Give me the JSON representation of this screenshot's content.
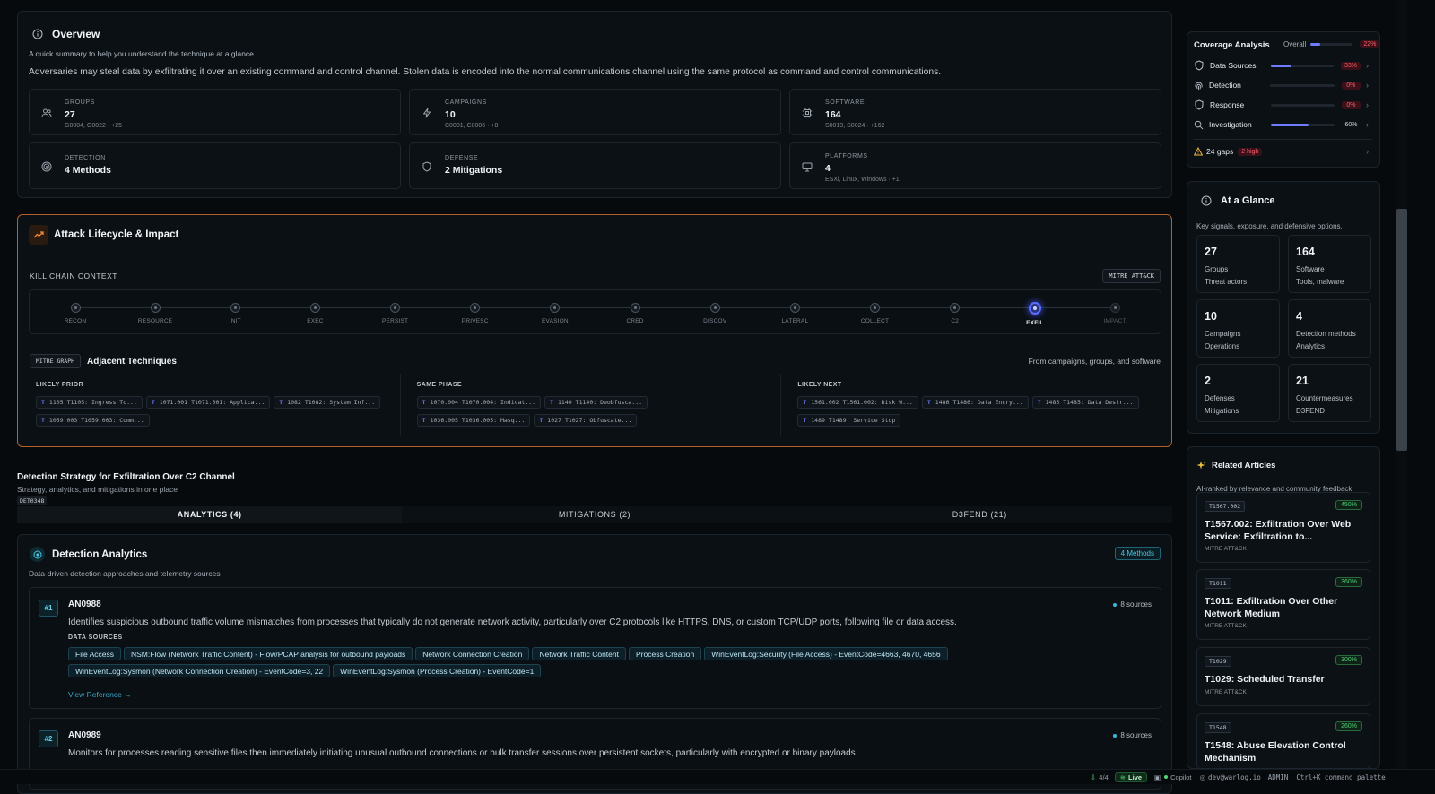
{
  "overview": {
    "title": "Overview",
    "subtitle": "A quick summary to help you understand the technique at a glance.",
    "description": "Adversaries may steal data by exfiltrating it over an existing command and control channel. Stolen data is encoded into the normal communications channel using the same protocol as command and control communications.",
    "stats": [
      {
        "label": "GROUPS",
        "value": "27",
        "sub": "G0004, G0022 · +25",
        "icon": "users-icon"
      },
      {
        "label": "CAMPAIGNS",
        "value": "10",
        "sub": "C0001, C0006 · +8",
        "icon": "lightning-icon"
      },
      {
        "label": "SOFTWARE",
        "value": "164",
        "sub": "S0013, S0024 · +162",
        "icon": "chip-icon"
      },
      {
        "label": "DETECTION",
        "value": "4 Methods",
        "sub": "",
        "icon": "target-icon"
      },
      {
        "label": "DEFENSE",
        "value": "2 Mitigations",
        "sub": "",
        "icon": "shield-icon"
      },
      {
        "label": "PLATFORMS",
        "value": "4",
        "sub": "ESXi, Linux, Windows · +1",
        "icon": "monitor-icon"
      }
    ]
  },
  "lifecycle": {
    "title": "Attack Lifecycle & Impact",
    "kill_chain_label": "KILL CHAIN CONTEXT",
    "badge": "MITRE ATT&CK",
    "phases": [
      "RECON",
      "RESOURCE",
      "INIT",
      "EXEC",
      "PERSIST",
      "PRIVESC",
      "EVASION",
      "CRED",
      "DISCOV",
      "LATERAL",
      "COLLECT",
      "C2",
      "EXFIL",
      "IMPACT"
    ],
    "active_phase": "EXFIL",
    "adjacent_badge": "MITRE GRAPH",
    "adjacent_title": "Adjacent Techniques",
    "adjacent_note": "From campaigns, groups, and software",
    "columns": [
      {
        "heading": "LIKELY PRIOR",
        "items": [
          {
            "id": "1105",
            "label": "T1105: Ingress To..."
          },
          {
            "id": "1071.001",
            "label": "T1071.001: Applica..."
          },
          {
            "id": "1082",
            "label": "T1082: System Inf..."
          },
          {
            "id": "1059.003",
            "label": "T1059.003: Comm..."
          }
        ]
      },
      {
        "heading": "SAME PHASE",
        "items": [
          {
            "id": "1070.004",
            "label": "T1070.004: Indicat..."
          },
          {
            "id": "1140",
            "label": "T1140: Deobfusca..."
          },
          {
            "id": "1036.005",
            "label": "T1036.005: Masq..."
          },
          {
            "id": "1027",
            "label": "T1027: Obfuscate..."
          }
        ]
      },
      {
        "heading": "LIKELY NEXT",
        "items": [
          {
            "id": "1561.002",
            "label": "T1561.002: Disk W..."
          },
          {
            "id": "1486",
            "label": "T1486: Data Encry..."
          },
          {
            "id": "1485",
            "label": "T1485: Data Destr..."
          },
          {
            "id": "1489",
            "label": "T1489: Service Stop"
          }
        ]
      }
    ]
  },
  "strategy": {
    "title": "Detection Strategy for Exfiltration Over C2 Channel",
    "subtitle": "Strategy, analytics, and mitigations in one place",
    "id": "DET0348",
    "tabs": [
      "ANALYTICS (4)",
      "MITIGATIONS (2)",
      "D3FEND (21)"
    ]
  },
  "analytics": {
    "title": "Detection Analytics",
    "subtitle": "Data-driven detection approaches and telemetry sources",
    "badge": "4 Methods",
    "data_sources_label": "DATA SOURCES",
    "items": [
      {
        "rank": "#1",
        "id": "AN0988",
        "sources": "8 sources",
        "description": "Identifies suspicious outbound traffic volume mismatches from processes that typically do not generate network activity, particularly over C2 protocols like HTTPS, DNS, or custom TCP/UDP ports, following file or data access.",
        "data_sources": [
          "File Access",
          "NSM:Flow (Network Traffic Content) - Flow/PCAP analysis for outbound payloads",
          "Network Connection Creation",
          "Network Traffic Content",
          "Process Creation",
          "WinEventLog:Security (File Access) - EventCode=4663, 4670, 4656",
          "WinEventLog:Sysmon (Network Connection Creation) - EventCode=3, 22",
          "WinEventLog:Sysmon (Process Creation) - EventCode=1"
        ],
        "link": "View Reference →"
      },
      {
        "rank": "#2",
        "id": "AN0989",
        "sources": "8 sources",
        "description": "Monitors for processes reading sensitive files then immediately initiating unusual outbound connections or bulk transfer sessions over persistent sockets, particularly with encrypted or binary payloads."
      }
    ]
  },
  "coverage": {
    "title": "Coverage Analysis",
    "overall_label": "Overall",
    "overall_value": "22%",
    "overall_fraction": 0.22,
    "rows": [
      {
        "name": "Data Sources",
        "value": "33%",
        "fraction": 0.33,
        "icon": "shield-icon",
        "bad": true
      },
      {
        "name": "Detection",
        "value": "0%",
        "fraction": 0,
        "icon": "fingerprint-icon",
        "bad": true
      },
      {
        "name": "Response",
        "value": "0%",
        "fraction": 0,
        "icon": "shield-icon",
        "bad": true
      },
      {
        "name": "Investigation",
        "value": "60%",
        "fraction": 0.6,
        "icon": "search-icon",
        "bad": false
      }
    ],
    "gaps": "24 gaps",
    "gaps_high": "2 high"
  },
  "glance": {
    "title": "At a Glance",
    "subtitle": "Key signals, exposure, and defensive options.",
    "cards": [
      {
        "n": "27",
        "a": "Groups",
        "b": "Threat actors"
      },
      {
        "n": "164",
        "a": "Software",
        "b": "Tools, malware"
      },
      {
        "n": "10",
        "a": "Campaigns",
        "b": "Operations"
      },
      {
        "n": "4",
        "a": "Detection methods",
        "b": "Analytics"
      },
      {
        "n": "2",
        "a": "Defenses",
        "b": "Mitigations"
      },
      {
        "n": "21",
        "a": "Countermeasures",
        "b": "D3FEND"
      }
    ]
  },
  "related": {
    "title": "Related Articles",
    "subtitle": "AI-ranked by relevance and community feedback",
    "articles": [
      {
        "id": "T1567.002",
        "pct": "450%",
        "title": "T1567.002: Exfiltration Over Web Service: Exfiltration to...",
        "src": "MITRE ATT&CK"
      },
      {
        "id": "T1011",
        "pct": "360%",
        "title": "T1011: Exfiltration Over Other Network Medium",
        "src": "MITRE ATT&CK"
      },
      {
        "id": "T1029",
        "pct": "300%",
        "title": "T1029: Scheduled Transfer",
        "src": "MITRE ATT&CK"
      },
      {
        "id": "T1548",
        "pct": "260%",
        "title": "T1548: Abuse Elevation Control Mechanism",
        "src": ""
      }
    ]
  },
  "statusbar": {
    "count": "4/4",
    "live": "Live",
    "copilot": "Copilot",
    "user": "dev@warlog.io",
    "role": "ADMIN",
    "shortcut": "Ctrl+K command palette"
  }
}
